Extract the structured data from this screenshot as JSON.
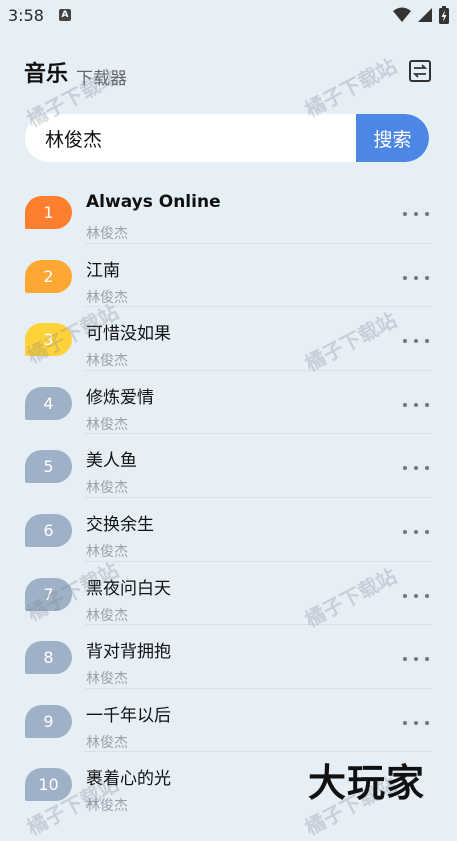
{
  "status_bar": {
    "time": "3:58",
    "notification_badge": "A"
  },
  "header": {
    "title": "音乐",
    "subtitle": "下载器",
    "swap_icon": "swap-icon"
  },
  "search": {
    "value": "林俊杰",
    "button_label": "搜索"
  },
  "songs": [
    {
      "rank": "1",
      "title": "Always Online",
      "artist": "林俊杰",
      "color": "#ff7f2e"
    },
    {
      "rank": "2",
      "title": "江南",
      "artist": "林俊杰",
      "color": "#ffa733"
    },
    {
      "rank": "3",
      "title": "可惜没如果",
      "artist": "林俊杰",
      "color": "#ffd23a"
    },
    {
      "rank": "4",
      "title": "修炼爱情",
      "artist": "林俊杰",
      "color": "#9fb1c6"
    },
    {
      "rank": "5",
      "title": "美人鱼",
      "artist": "林俊杰",
      "color": "#9fb1c6"
    },
    {
      "rank": "6",
      "title": "交换余生",
      "artist": "林俊杰",
      "color": "#9fb1c6"
    },
    {
      "rank": "7",
      "title": "黑夜问白天",
      "artist": "林俊杰",
      "color": "#9fb1c6"
    },
    {
      "rank": "8",
      "title": "背对背拥抱",
      "artist": "林俊杰",
      "color": "#9fb1c6"
    },
    {
      "rank": "9",
      "title": "一千年以后",
      "artist": "林俊杰",
      "color": "#9fb1c6"
    },
    {
      "rank": "10",
      "title": "裹着心的光",
      "artist": "林俊杰",
      "color": "#9fb1c6"
    }
  ],
  "watermark_text": "橘子下载站",
  "brand_logo": "大玩家"
}
